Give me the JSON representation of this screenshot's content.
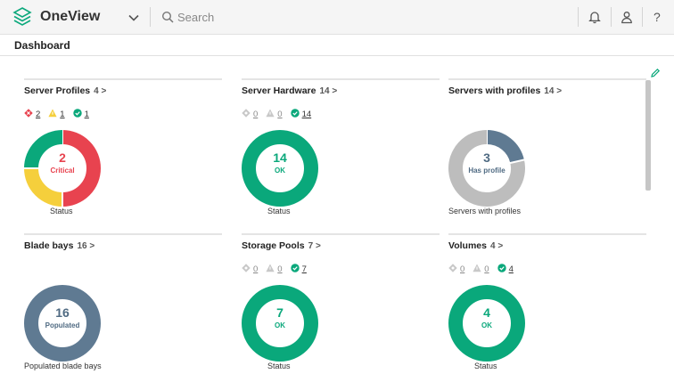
{
  "header": {
    "app_name": "OneView",
    "search_placeholder": "Search",
    "help_label": "?"
  },
  "page": {
    "title": "Dashboard"
  },
  "colors": {
    "critical": "#e8434f",
    "warning": "#f5cf3c",
    "ok": "#0aa87b",
    "disabled": "#c8c8c8",
    "populated": "#5f7a92",
    "unprofiled": "#bdbdbd"
  },
  "panels": [
    {
      "title": "Server Profiles",
      "count": "4 >",
      "statuses": [
        {
          "kind": "critical",
          "value": "2"
        },
        {
          "kind": "warning",
          "value": "1"
        },
        {
          "kind": "ok",
          "value": "1"
        }
      ],
      "donut": {
        "number": "2",
        "label": "Critical",
        "number_color": "#e8434f",
        "segments": [
          {
            "kind": "critical",
            "value": 2
          },
          {
            "kind": "warning",
            "value": 1
          },
          {
            "kind": "ok",
            "value": 1
          }
        ]
      },
      "caption": "Status"
    },
    {
      "title": "Server Hardware",
      "count": "14 >",
      "statuses": [
        {
          "kind": "disabled",
          "value": "0"
        },
        {
          "kind": "unknown",
          "value": "0"
        },
        {
          "kind": "ok",
          "value": "14"
        }
      ],
      "donut": {
        "number": "14",
        "label": "OK",
        "number_color": "#0aa87b",
        "segments": [
          {
            "kind": "ok",
            "value": 14
          }
        ]
      },
      "caption": "Status"
    },
    {
      "title": "Servers with profiles",
      "count": "14 >",
      "statuses": [],
      "donut": {
        "number": "3",
        "label": "Has profile",
        "number_color": "#4f6a82",
        "segments": [
          {
            "kind": "populated",
            "value": 3
          },
          {
            "kind": "unprofiled",
            "value": 11
          }
        ]
      },
      "caption": "Servers with profiles"
    },
    {
      "title": "Blade bays",
      "count": "16 >",
      "statuses": [],
      "donut": {
        "number": "16",
        "label": "Populated",
        "number_color": "#4f6a82",
        "segments": [
          {
            "kind": "populated",
            "value": 16
          }
        ]
      },
      "caption": "Populated blade bays"
    },
    {
      "title": "Storage Pools",
      "count": "7 >",
      "statuses": [
        {
          "kind": "disabled",
          "value": "0"
        },
        {
          "kind": "unknown",
          "value": "0"
        },
        {
          "kind": "ok",
          "value": "7"
        }
      ],
      "donut": {
        "number": "7",
        "label": "OK",
        "number_color": "#0aa87b",
        "segments": [
          {
            "kind": "ok",
            "value": 7
          }
        ]
      },
      "caption": "Status"
    },
    {
      "title": "Volumes",
      "count": "4 >",
      "statuses": [
        {
          "kind": "disabled",
          "value": "0"
        },
        {
          "kind": "unknown",
          "value": "0"
        },
        {
          "kind": "ok",
          "value": "4"
        }
      ],
      "donut": {
        "number": "4",
        "label": "OK",
        "number_color": "#0aa87b",
        "segments": [
          {
            "kind": "ok",
            "value": 4
          }
        ]
      },
      "caption": "Status"
    }
  ]
}
